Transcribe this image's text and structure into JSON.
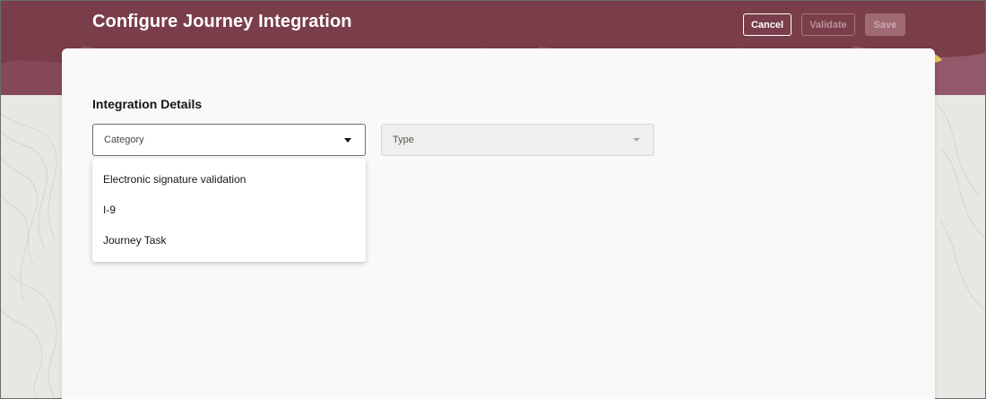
{
  "page": {
    "title": "Configure Journey Integration"
  },
  "toolbar": {
    "cancel_label": "Cancel",
    "validate_label": "Validate",
    "save_label": "Save"
  },
  "section": {
    "title": "Integration Details"
  },
  "fields": {
    "category": {
      "placeholder": "Category",
      "expanded": true,
      "options": [
        "Electronic signature validation",
        "I-9",
        "Journey Task"
      ]
    },
    "type": {
      "placeholder": "Type",
      "disabled": true
    }
  },
  "colors": {
    "header": "#7a3e4a",
    "accent_yellow": "#e7c75a",
    "card_background": "#faf9f8"
  },
  "icons": {
    "category_dropdown": "caret-down-icon",
    "type_dropdown": "caret-down-icon"
  }
}
